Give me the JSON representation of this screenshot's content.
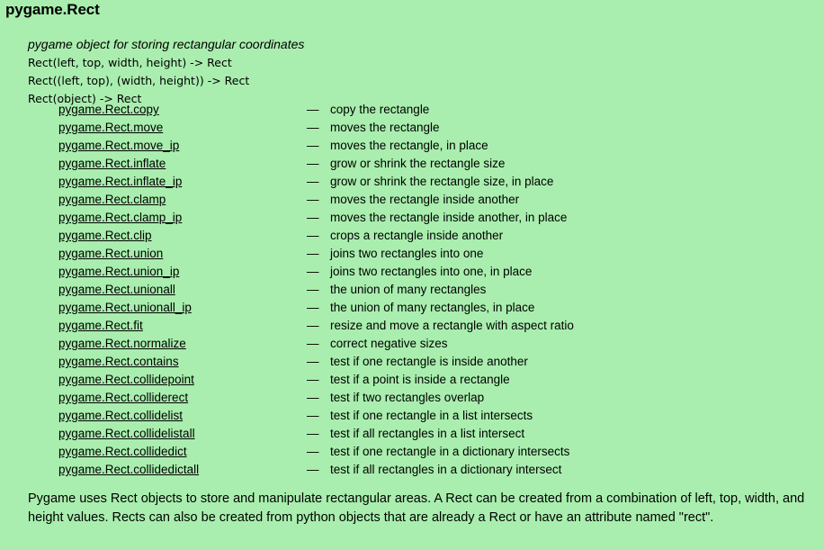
{
  "page": {
    "title": "pygame.Rect",
    "summary": "pygame object for storing rectangular coordinates",
    "background_color": "#a9eeae",
    "text_color": "#000000",
    "link_color": "#000000"
  },
  "signatures": [
    "Rect(left, top, width, height) -> Rect",
    "Rect((left, top), (width, height)) -> Rect",
    "Rect(object) -> Rect"
  ],
  "separator": "—",
  "methods": [
    {
      "name": "pygame.Rect.copy",
      "description": "copy the rectangle"
    },
    {
      "name": "pygame.Rect.move",
      "description": "moves the rectangle"
    },
    {
      "name": "pygame.Rect.move_ip",
      "description": "moves the rectangle, in place"
    },
    {
      "name": "pygame.Rect.inflate",
      "description": "grow or shrink the rectangle size"
    },
    {
      "name": "pygame.Rect.inflate_ip",
      "description": "grow or shrink the rectangle size, in place"
    },
    {
      "name": "pygame.Rect.clamp",
      "description": "moves the rectangle inside another"
    },
    {
      "name": "pygame.Rect.clamp_ip",
      "description": "moves the rectangle inside another, in place"
    },
    {
      "name": "pygame.Rect.clip",
      "description": "crops a rectangle inside another"
    },
    {
      "name": "pygame.Rect.union",
      "description": "joins two rectangles into one"
    },
    {
      "name": "pygame.Rect.union_ip",
      "description": "joins two rectangles into one, in place"
    },
    {
      "name": "pygame.Rect.unionall",
      "description": "the union of many rectangles"
    },
    {
      "name": "pygame.Rect.unionall_ip",
      "description": "the union of many rectangles, in place"
    },
    {
      "name": "pygame.Rect.fit",
      "description": "resize and move a rectangle with aspect ratio"
    },
    {
      "name": "pygame.Rect.normalize",
      "description": "correct negative sizes"
    },
    {
      "name": "pygame.Rect.contains",
      "description": "test if one rectangle is inside another"
    },
    {
      "name": "pygame.Rect.collidepoint",
      "description": "test if a point is inside a rectangle"
    },
    {
      "name": "pygame.Rect.colliderect",
      "description": "test if two rectangles overlap"
    },
    {
      "name": "pygame.Rect.collidelist",
      "description": "test if one rectangle in a list intersects"
    },
    {
      "name": "pygame.Rect.collidelistall",
      "description": "test if all rectangles in a list intersect"
    },
    {
      "name": "pygame.Rect.collidedict",
      "description": "test if one rectangle in a dictionary intersects"
    },
    {
      "name": "pygame.Rect.collidedictall",
      "description": "test if all rectangles in a dictionary intersect"
    }
  ],
  "description": "Pygame uses Rect objects to store and manipulate rectangular areas. A Rect can be created from a combination of left, top, width, and height values. Rects can also be created from python objects that are already a Rect or have an attribute named \"rect\"."
}
